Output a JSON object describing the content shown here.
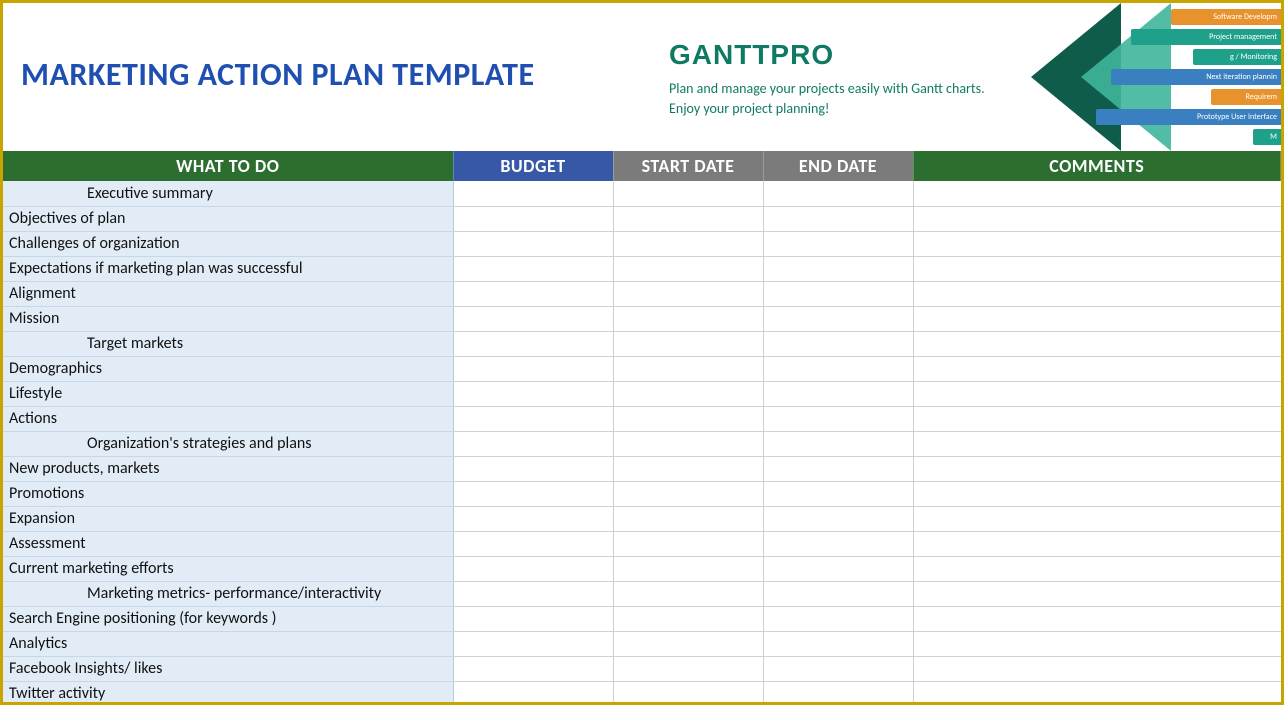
{
  "header": {
    "title": "MARKETING ACTION PLAN TEMPLATE",
    "brand": "GANTTPRO",
    "tagline1": "Plan and manage your projects easily with Gantt charts.",
    "tagline2": "Enjoy your project planning!",
    "decor_bars": [
      {
        "label": "Software Developm",
        "w": 110,
        "color": "#e8922e"
      },
      {
        "label": "Project management",
        "w": 150,
        "color": "#1fa08a"
      },
      {
        "label": "g / Monitoring",
        "w": 88,
        "color": "#1fa08a"
      },
      {
        "label": "Next iteration plannin",
        "w": 170,
        "color": "#3a7fbf"
      },
      {
        "label": "Requirem",
        "w": 70,
        "color": "#e8922e"
      },
      {
        "label": "Prototype User Interface",
        "w": 185,
        "color": "#3a7fbf"
      },
      {
        "label": "M",
        "w": 28,
        "color": "#1fa08a"
      }
    ]
  },
  "columns": {
    "what": "WHAT TO DO",
    "budget": "BUDGET",
    "start": "START DATE",
    "end": "END DATE",
    "comments": "COMMENTS"
  },
  "rows": [
    {
      "label": "Executive summary",
      "section": true
    },
    {
      "label": "Objectives of plan"
    },
    {
      "label": "Challenges of organization"
    },
    {
      "label": "Expectations if marketing plan was successful"
    },
    {
      "label": "Alignment"
    },
    {
      "label": "Mission"
    },
    {
      "label": "Target markets",
      "section": true
    },
    {
      "label": "Demographics"
    },
    {
      "label": "Lifestyle"
    },
    {
      "label": "Actions"
    },
    {
      "label": "Organization's strategies and plans",
      "section": true
    },
    {
      "label": "New products, markets"
    },
    {
      "label": "Promotions"
    },
    {
      "label": "Expansion"
    },
    {
      "label": "Assessment"
    },
    {
      "label": "Current marketing efforts"
    },
    {
      "label": "Marketing metrics- performance/interactivity",
      "section": true
    },
    {
      "label": "Search Engine positioning (for keywords )"
    },
    {
      "label": "Analytics"
    },
    {
      "label": "Facebook Insights/ likes"
    },
    {
      "label": "Twitter activity"
    }
  ]
}
